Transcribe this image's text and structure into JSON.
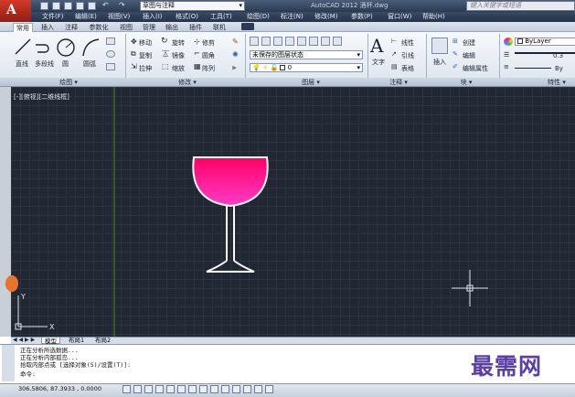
{
  "titlebar": {
    "workspace": "草图与注释",
    "app_title": "AutoCAD 2012   酒杯.dwg",
    "search_placeholder": "键入关键字或短语"
  },
  "menu": [
    "文件(F)",
    "编辑(E)",
    "视图(V)",
    "插入(I)",
    "格式(O)",
    "工具(T)",
    "绘图(D)",
    "标注(N)",
    "修改(M)",
    "参数(P)",
    "窗口(W)",
    "帮助(H)"
  ],
  "tabs": [
    "常用",
    "插入",
    "注释",
    "参数化",
    "视图",
    "管理",
    "输出",
    "插件",
    "联机"
  ],
  "ribbon": {
    "draw_tools": [
      "直线",
      "多段线",
      "圆",
      "圆弧"
    ],
    "modify_tools": [
      "移动",
      "旋转",
      "修剪",
      "复制",
      "镜像",
      "圆角",
      "拉伸",
      "缩放",
      "阵列"
    ],
    "layer_state": "未保存的图层状态",
    "layer_current": "0",
    "annotation": {
      "text": "文字",
      "linear": "线性",
      "leader": "引线",
      "table": "表格"
    },
    "block": {
      "insert": "插入",
      "create": "创建",
      "edit": "编辑",
      "edit_attr": "编辑属性"
    },
    "properties": {
      "layer": "ByLayer",
      "lineweight": "0.3",
      "linetype": "By"
    }
  },
  "panels": [
    "绘图",
    "修改",
    "图层",
    "注释",
    "块",
    "特性"
  ],
  "viewport": {
    "label": "[-][俯视][二维线框]"
  },
  "layout_tabs": [
    "模型",
    "布局1",
    "布局2"
  ],
  "command": {
    "lines": [
      "正在分析所选数据...",
      "正在分析内部孤岛...",
      "拾取内部点或 [选择对象(S)/设置(T)]:",
      "命令:"
    ]
  },
  "status": {
    "coords": "306.5806, 87.3933 , 0.0000"
  },
  "watermark": "最需网",
  "colors": {
    "background": "#212833",
    "glass_top": "#ff0066",
    "glass_fill": "#ff33aa",
    "accent": "#d23a2a"
  }
}
